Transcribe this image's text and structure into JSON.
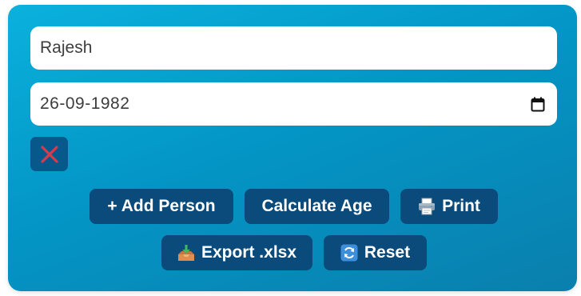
{
  "form": {
    "name_value": "Rajesh",
    "dob_value": "26-09-1982"
  },
  "buttons": {
    "add_person": "+ Add Person",
    "calculate_age": "Calculate Age",
    "print": "Print",
    "export": "Export .xlsx",
    "reset": "Reset"
  },
  "icons": {
    "remove": "close-x-icon",
    "calendar": "calendar-icon",
    "print": "printer-icon",
    "export": "inbox-tray-icon",
    "reset": "refresh-icon"
  },
  "colors": {
    "card_gradient_start": "#0bb1dd",
    "card_gradient_end": "#0a7fad",
    "button_bg": "#0a4b7c",
    "remove_x": "#d9394b"
  }
}
